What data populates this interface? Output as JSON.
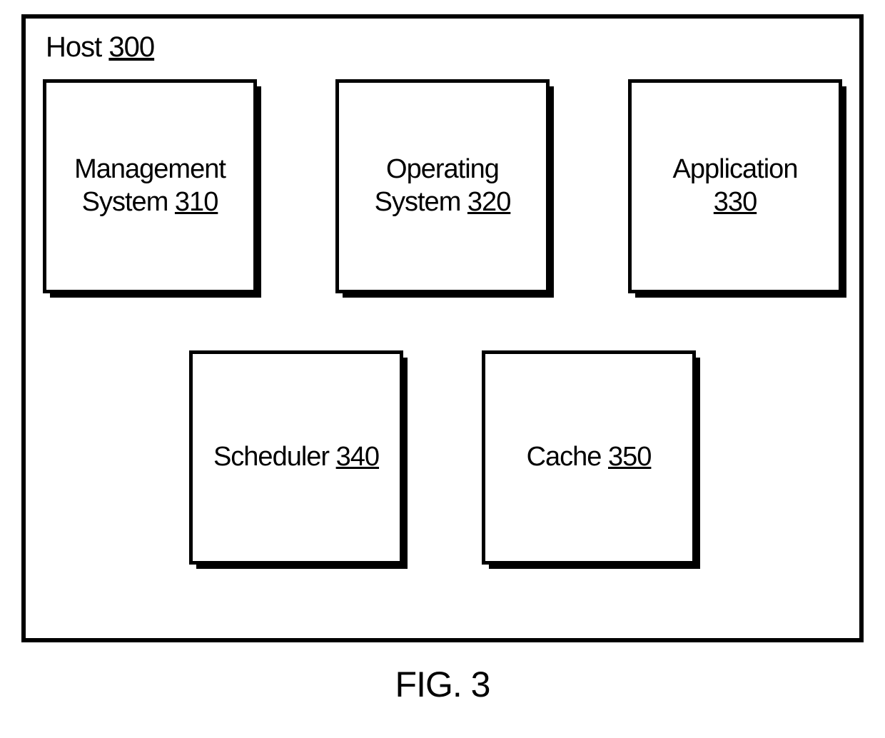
{
  "host": {
    "label": "Host",
    "ref": "300"
  },
  "blocks": {
    "row1": [
      {
        "line1": "Management",
        "line2": "System",
        "ref": "310"
      },
      {
        "line1": "Operating",
        "line2": "System",
        "ref": "320"
      },
      {
        "line1": "Application",
        "line2": "",
        "ref": "330"
      }
    ],
    "row2": [
      {
        "line1": "Scheduler",
        "line2": "",
        "ref": "340"
      },
      {
        "line1": "Cache",
        "line2": "",
        "ref": "350"
      }
    ]
  },
  "figure": "FIG. 3"
}
